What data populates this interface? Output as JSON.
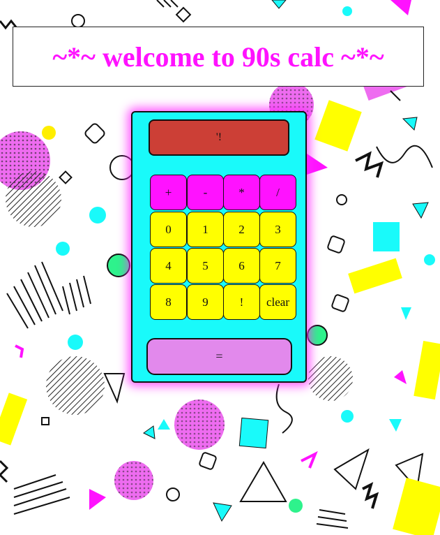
{
  "title": "~*~ welcome to 90s calc ~*~",
  "display": {
    "value": "'!"
  },
  "operators": [
    "+",
    "-",
    "*",
    "/"
  ],
  "keys": [
    [
      "0",
      "1",
      "2",
      "3"
    ],
    [
      "4",
      "5",
      "6",
      "7"
    ],
    [
      "8",
      "9",
      "!",
      "clear"
    ]
  ],
  "equals_label": "=",
  "colors": {
    "title": "#ff12ff",
    "calculator_body": "#19fafa",
    "display": "#cc3f36",
    "operator_buttons": "#ff12ff",
    "number_buttons": "#ffff00",
    "equals_button": "#e289ec",
    "glow": "#ff28ff"
  }
}
